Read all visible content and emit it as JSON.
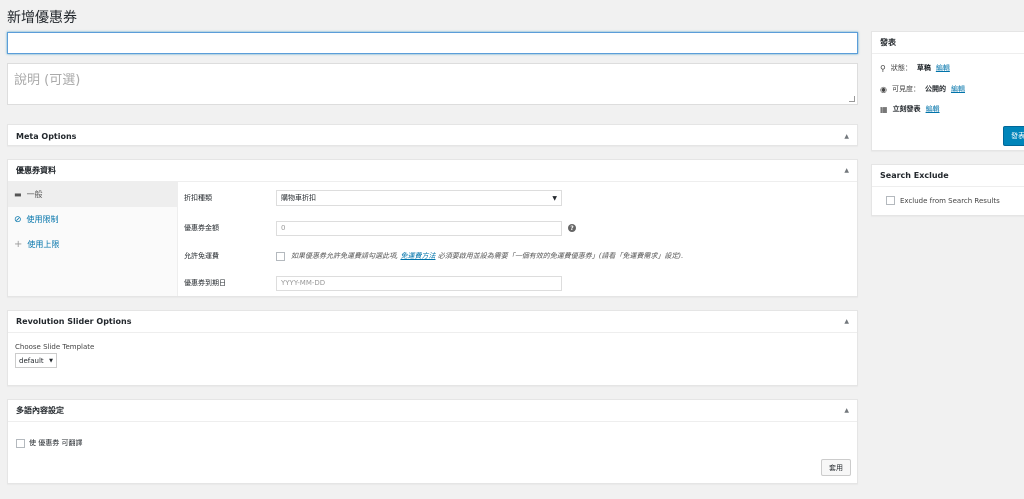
{
  "page_title": "新增優惠券",
  "title_input": {
    "value": "",
    "placeholder": ""
  },
  "excerpt": {
    "placeholder": "說明 (可選)"
  },
  "meta_options": {
    "title": "Meta Options"
  },
  "coupon_data": {
    "title": "優惠券資料",
    "tabs": [
      {
        "label": "一般",
        "icon": "ticket-icon"
      },
      {
        "label": "使用限制",
        "icon": "ban-icon"
      },
      {
        "label": "使用上限",
        "icon": "plus-icon"
      }
    ],
    "fields": {
      "discount_type": {
        "label": "折扣種類",
        "value": "購物車折扣"
      },
      "coupon_amount": {
        "label": "優惠券金額",
        "value": "0"
      },
      "free_shipping": {
        "label": "允許免運費",
        "desc_before": "如果優惠券允許免運費請勾選此項,",
        "desc_link": "免運費方法",
        "desc_after": "必須要啟用並設為需要「一個有效的免運費優惠券」(請看「免運費需求」設定)."
      },
      "expiry_date": {
        "label": "優惠券到期日",
        "placeholder": "YYYY-MM-DD"
      }
    }
  },
  "revolution": {
    "title": "Revolution Slider Options",
    "choose_label": "Choose Slide Template",
    "template_value": "default"
  },
  "multilingual": {
    "title": "多語內容設定",
    "checkbox_label": "使 優惠券 可翻譯",
    "apply_label": "套用"
  },
  "publish": {
    "title": "發表",
    "status_label": "狀態：",
    "status_value": "草稿",
    "status_edit": "編輯",
    "visibility_label": "可見度：",
    "visibility_value": "公開的",
    "visibility_edit": "編輯",
    "schedule_label": "立刻發表",
    "schedule_edit": "編輯",
    "button_label": "發表"
  },
  "search_exclude": {
    "title": "Search Exclude",
    "checkbox_label": "Exclude from Search Results"
  },
  "colors": {
    "accent": "#0073aa",
    "button": "#0085ba",
    "background": "#f1f1f1"
  }
}
